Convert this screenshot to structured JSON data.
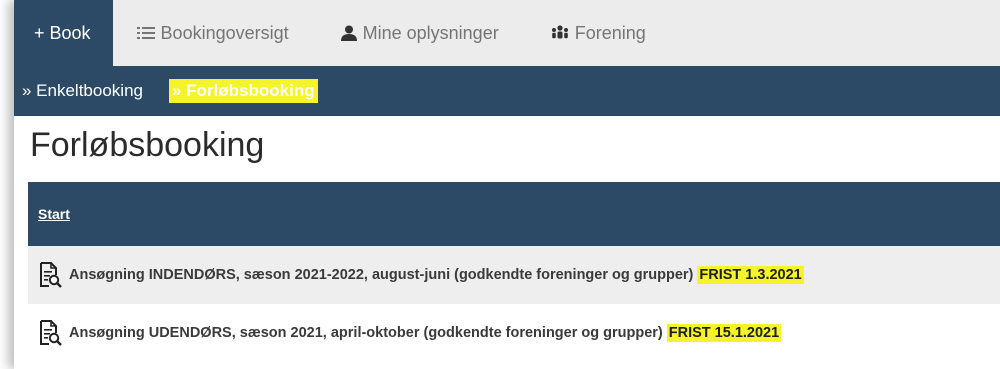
{
  "topnav": {
    "items": [
      {
        "label": "+ Book",
        "icon": "plus-icon",
        "active": true
      },
      {
        "label": "Bookingoversigt",
        "icon": "list-icon"
      },
      {
        "label": "Mine oplysninger",
        "icon": "user-icon"
      },
      {
        "label": "Forening",
        "icon": "group-icon"
      }
    ]
  },
  "subnav": {
    "items": [
      {
        "label": "» Enkeltbooking"
      },
      {
        "label": "» Forløbsbooking",
        "active": true
      }
    ]
  },
  "page": {
    "title": "Forløbsbooking"
  },
  "table": {
    "header": "Start",
    "rows": [
      {
        "text": "Ansøgning INDENDØRS, sæson 2021-2022, august-juni (godkendte foreninger og grupper)",
        "deadline": "FRIST 1.3.2021"
      },
      {
        "text": "Ansøgning UDENDØRS, sæson 2021, april-oktober (godkendte foreninger og grupper)",
        "deadline": "FRIST 15.1.2021"
      }
    ]
  },
  "colors": {
    "nav_dark": "#2c4a66",
    "highlight": "#f5f32a",
    "nav_light": "#ececec"
  }
}
